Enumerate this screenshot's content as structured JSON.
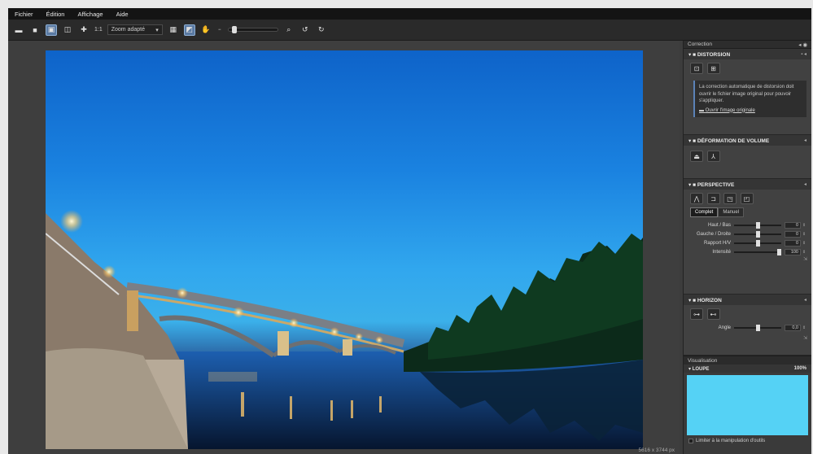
{
  "menu": [
    "Fichier",
    "Édition",
    "Affichage",
    "Aide"
  ],
  "toolbar": {
    "ratio_label": "1:1",
    "zoom_value": "Zoom adapté"
  },
  "status_bar": "5616 x 3744 px",
  "panel": {
    "title": "Correction",
    "distorsion": {
      "title": "DISTORSION",
      "info_text": "La correction automatique de distorsion doit ouvrir le fichier image original pour pouvoir s'appliquer.",
      "link": "Ouvrir l'image originale"
    },
    "volume": {
      "title": "DÉFORMATION DE VOLUME"
    },
    "perspective": {
      "title": "PERSPECTIVE",
      "modes": [
        "Complet",
        "Manuel"
      ],
      "sliders": [
        {
          "label": "Haut / Bas",
          "value": "0",
          "level": 0.5
        },
        {
          "label": "Gauche / Droite",
          "value": "0",
          "level": 0.5
        },
        {
          "label": "Rapport H/V",
          "value": "0",
          "level": 0.5
        },
        {
          "label": "Intensité",
          "value": "100",
          "level": 1.0
        }
      ]
    },
    "horizon": {
      "title": "HORIZON",
      "angle_label": "Angle",
      "angle_value": "0,0",
      "level": 0.5
    }
  },
  "visualisation": {
    "title": "Visualisation",
    "loupe_label": "LOUPE",
    "loupe_zoom": "100%",
    "footer": "Limiter à la manipulation d'outils"
  },
  "colors": {
    "accent": "#5a7aa3",
    "loupe": "#55d2f5",
    "sky": "#1a82e0"
  }
}
